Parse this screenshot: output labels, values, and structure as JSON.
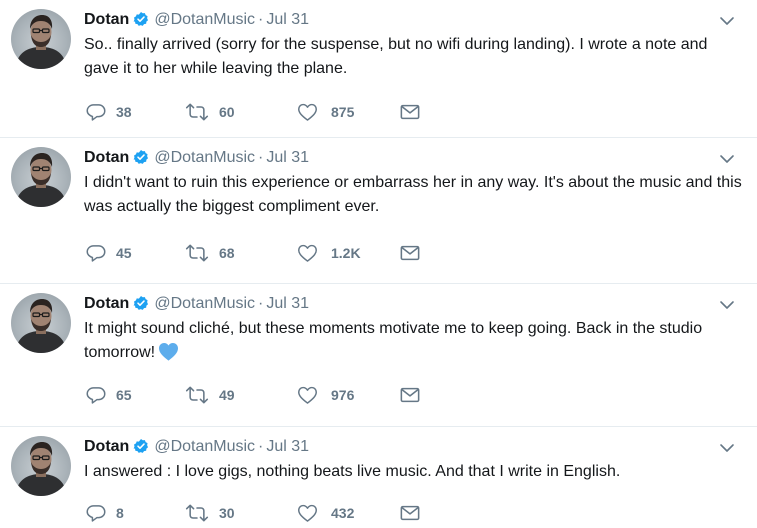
{
  "tweets": [
    {
      "name": "Dotan",
      "handle": "@DotanMusic",
      "date": "Jul 31",
      "text": "So.. finally arrived (sorry for the suspense, but no wifi during landing). I wrote a note and gave it to her while leaving the plane.",
      "emoji": "",
      "replies": "38",
      "retweets": "60",
      "likes": "875"
    },
    {
      "name": "Dotan",
      "handle": "@DotanMusic",
      "date": "Jul 31",
      "text": "I didn't want to ruin this experience or embarrass her in any way. It's about the music and this was actually the biggest compliment ever.",
      "emoji": "",
      "replies": "45",
      "retweets": "68",
      "likes": "1.2K"
    },
    {
      "name": "Dotan",
      "handle": "@DotanMusic",
      "date": "Jul 31",
      "text": "It might sound cliché, but these moments motivate me to keep going. Back in the studio tomorrow!",
      "emoji": "blue-heart-emoji",
      "replies": "65",
      "retweets": "49",
      "likes": "976"
    },
    {
      "name": "Dotan",
      "handle": "@DotanMusic",
      "date": "Jul 31",
      "text": "I answered : I love gigs, nothing beats live music. And that I write in English.",
      "emoji": "",
      "replies": "8",
      "retweets": "30",
      "likes": "432"
    }
  ],
  "separator": "·",
  "colors": {
    "text": "#14171a",
    "secondary": "#657786",
    "verified": "#1da1f2",
    "divider": "#e6ecf0",
    "heart_emoji": "#5dadec"
  },
  "icons": [
    "verified-badge-icon",
    "chevron-down-icon",
    "reply-icon",
    "retweet-icon",
    "like-icon",
    "direct-message-icon"
  ]
}
